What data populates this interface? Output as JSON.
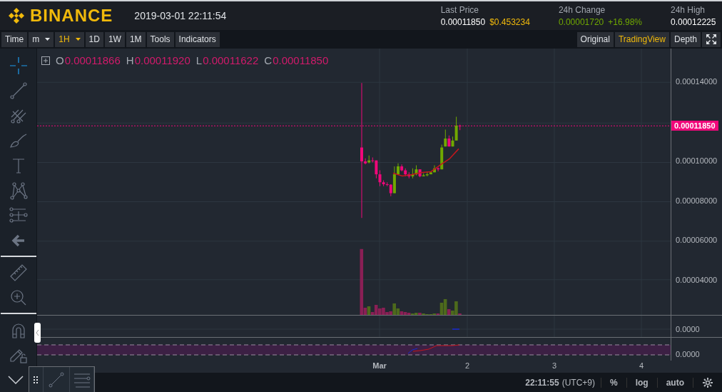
{
  "header": {
    "logo": "BINANCE",
    "datetime": "2019-03-01 22:11:54",
    "stats": [
      {
        "label": "Last Price",
        "values": [
          {
            "text": "0.00011850",
            "color": "#ffffff"
          },
          {
            "text": "$0.453234",
            "color": "#f0b90b"
          }
        ]
      },
      {
        "label": "24h Change",
        "values": [
          {
            "text": "0.00001720",
            "color": "#70a800"
          },
          {
            "text": "+16.98%",
            "color": "#70a800"
          }
        ]
      },
      {
        "label": "24h High",
        "values": [
          {
            "text": "0.00012225",
            "color": "#ffffff"
          }
        ]
      }
    ]
  },
  "toolbar": {
    "controls": [
      {
        "label": "Time",
        "kind": "button",
        "selected": false
      },
      {
        "label": "m",
        "kind": "dropdown",
        "selected": false
      },
      {
        "label": "1H",
        "kind": "dropdown",
        "selected": true
      },
      {
        "label": "1D",
        "kind": "button",
        "selected": false
      },
      {
        "label": "1W",
        "kind": "button",
        "selected": false
      },
      {
        "label": "1M",
        "kind": "button",
        "selected": false
      },
      {
        "label": "Tools",
        "kind": "button",
        "selected": false
      },
      {
        "label": "Indicators",
        "kind": "button",
        "selected": false
      }
    ],
    "views": [
      {
        "label": "Original",
        "selected": false
      },
      {
        "label": "TradingView",
        "selected": true
      },
      {
        "label": "Depth",
        "selected": false
      }
    ]
  },
  "drawing_tools": [
    {
      "kind": "crosshair",
      "selected": true
    },
    {
      "kind": "trendline",
      "selected": false
    },
    {
      "kind": "pitchfork",
      "selected": false
    },
    {
      "kind": "brush",
      "selected": false
    },
    {
      "kind": "text",
      "selected": false
    },
    {
      "kind": "pattern",
      "selected": false
    },
    {
      "kind": "fibonacci",
      "selected": false
    },
    {
      "kind": "back",
      "selected": false
    },
    {
      "kind": "divider"
    },
    {
      "kind": "ruler",
      "selected": false
    },
    {
      "kind": "zoom",
      "selected": false
    },
    {
      "kind": "divider"
    },
    {
      "kind": "magnet",
      "selected": false
    },
    {
      "kind": "lock",
      "selected": false
    }
  ],
  "legend": [
    {
      "key": "O",
      "value": "0.00011866"
    },
    {
      "key": "H",
      "value": "0.00011920"
    },
    {
      "key": "L",
      "value": "0.00011622"
    },
    {
      "key": "C",
      "value": "0.00011850"
    }
  ],
  "price_axis": {
    "ticks": [
      "0.00014000",
      "0.00010000",
      "0.00008000",
      "0.00006000",
      "0.00004000"
    ],
    "last_price": "0.00011850"
  },
  "indicator_axes": [
    "0.0000",
    "0.0000"
  ],
  "time_axis": [
    {
      "label": "Mar",
      "kind": "month"
    },
    {
      "label": "2",
      "kind": "day"
    },
    {
      "label": "3",
      "kind": "day"
    },
    {
      "label": "4",
      "kind": "day"
    }
  ],
  "status_bar": {
    "time": "22:11:55",
    "timezone": "(UTC+9)",
    "options": [
      "%",
      "log",
      "auto"
    ]
  }
}
